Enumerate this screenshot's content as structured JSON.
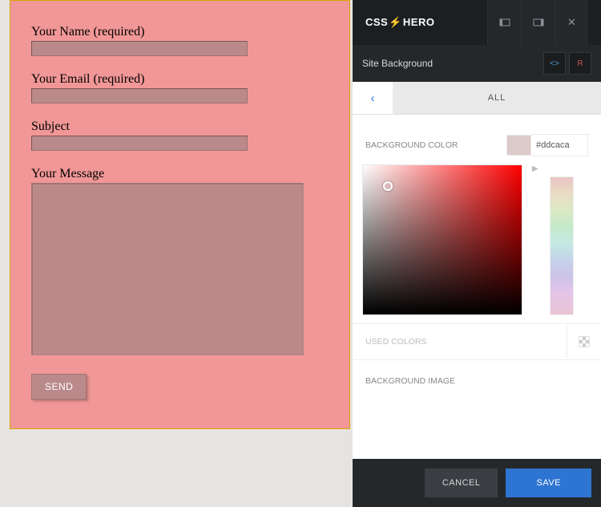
{
  "form": {
    "name_label": "Your Name (required)",
    "email_label": "Your Email (required)",
    "subject_label": "Subject",
    "message_label": "Your Message",
    "send_label": "SEND"
  },
  "brand": {
    "left": "CSS",
    "right": "HERO"
  },
  "header": {
    "selected_element": "Site Background",
    "reset": "R"
  },
  "tabs": {
    "all": "ALL"
  },
  "color": {
    "section_label": "BACKGROUND COLOR",
    "hex": "#ddcaca",
    "swatch": "#ddcaca"
  },
  "used_colors_label": "USED COLORS",
  "bgimage_label": "BACKGROUND IMAGE",
  "footer": {
    "cancel": "CANCEL",
    "save": "SAVE"
  }
}
